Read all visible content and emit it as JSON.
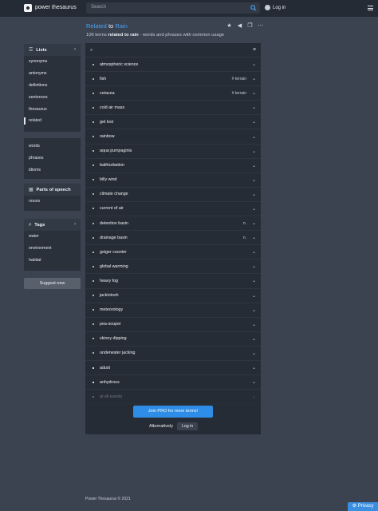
{
  "header": {
    "brand": "power thesaurus",
    "search_placeholder": "Search",
    "login": "Log in"
  },
  "heading": {
    "related": "Related",
    "to": "to",
    "word": "Rain",
    "subtitle_pre": "106 terms ",
    "subtitle_bold": "related to rain",
    "subtitle_post": " - words and phrases with common usage"
  },
  "sidebar": {
    "lists_title": "Lists",
    "lists": [
      "synonyms",
      "antonyms",
      "definitions",
      "sentences",
      "thesaurus",
      "related"
    ],
    "forms": [
      "words",
      "phrases",
      "idioms"
    ],
    "pos_title": "Parts of speech",
    "pos": [
      "nouns"
    ],
    "tags_title": "Tags",
    "tags": [
      "water",
      "environment",
      "habitat"
    ],
    "suggest": "Suggest new"
  },
  "terms": [
    {
      "t": "atmospheric science",
      "tag": ""
    },
    {
      "t": "fish",
      "tag": "# terrain"
    },
    {
      "t": "cetacea",
      "tag": "# terrain"
    },
    {
      "t": "cold air mass",
      "tag": ""
    },
    {
      "t": "get lost",
      "tag": ""
    },
    {
      "t": "rainbow",
      "tag": ""
    },
    {
      "t": "aqua pumpaginis",
      "tag": ""
    },
    {
      "t": "bathturbation",
      "tag": ""
    },
    {
      "t": "billy wind",
      "tag": ""
    },
    {
      "t": "climate change",
      "tag": ""
    },
    {
      "t": "current of air",
      "tag": ""
    },
    {
      "t": "detention basin",
      "tag": "n."
    },
    {
      "t": "drainage basin",
      "tag": "n."
    },
    {
      "t": "geiger counter",
      "tag": ""
    },
    {
      "t": "global warming",
      "tag": ""
    },
    {
      "t": "heavy fog",
      "tag": ""
    },
    {
      "t": "jackintosh",
      "tag": ""
    },
    {
      "t": "meteorology",
      "tag": ""
    },
    {
      "t": "pea-souper",
      "tag": ""
    },
    {
      "t": "skinny dipping",
      "tag": ""
    },
    {
      "t": "underwater jacking",
      "tag": ""
    },
    {
      "t": "adust",
      "tag": ""
    },
    {
      "t": "anhydrous",
      "tag": ""
    },
    {
      "t": "at all events",
      "tag": ""
    }
  ],
  "cta": {
    "pro": "Join PRO for more terms!",
    "alternatively": "Alternatively",
    "login": "Log in"
  },
  "footer": "Power Thesaurus © 2021",
  "privacy": "Privacy"
}
